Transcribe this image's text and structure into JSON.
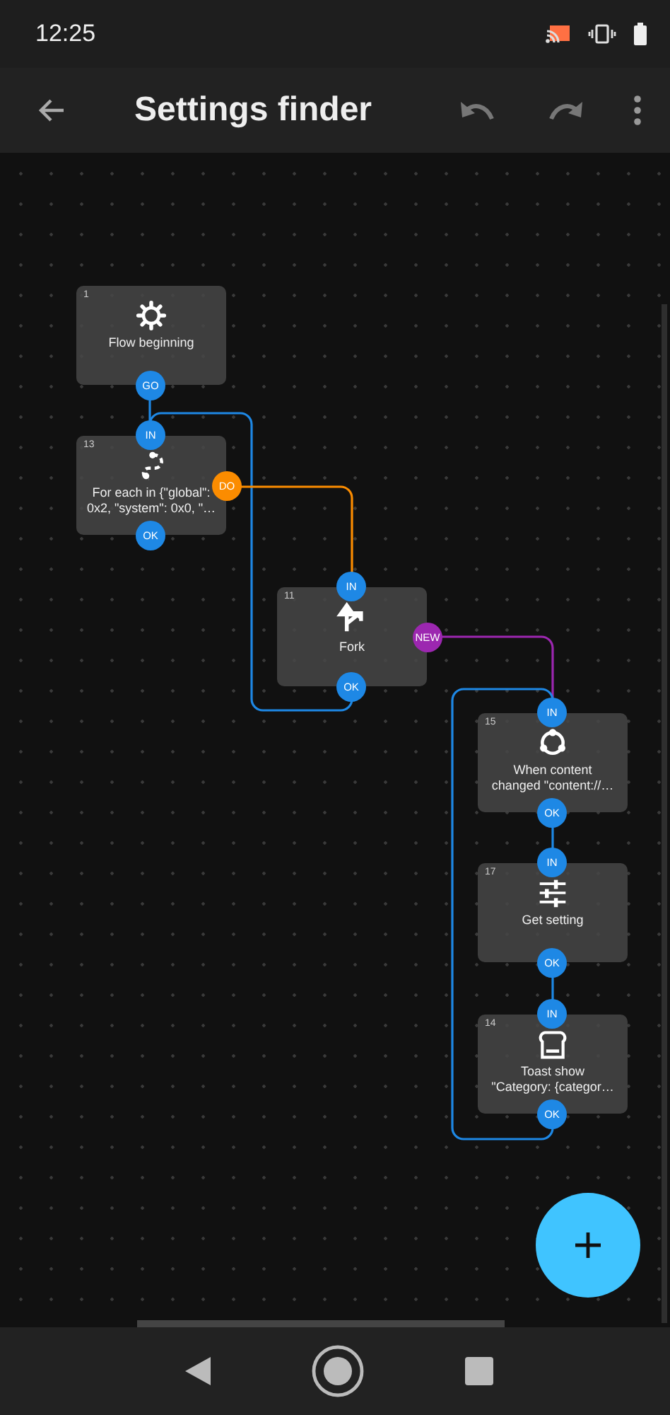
{
  "status_bar": {
    "time": "12:25"
  },
  "app_bar": {
    "title": "Settings finder"
  },
  "nodes": [
    {
      "number": "1",
      "kind": "gear",
      "title": "Flow beginning",
      "ports": [
        {
          "label": "GO",
          "color": "#1e88e5"
        }
      ]
    },
    {
      "number": "13",
      "kind": "loop",
      "title": "For each in {\"global\":\n0x2, \"system\": 0x0, \"…",
      "ports": [
        {
          "label": "IN",
          "color": "#1e88e5"
        },
        {
          "label": "DO",
          "color": "#fb8c00"
        },
        {
          "label": "OK",
          "color": "#1e88e5"
        }
      ]
    },
    {
      "number": "11",
      "kind": "fork",
      "title": "Fork",
      "ports": [
        {
          "label": "IN",
          "color": "#1e88e5"
        },
        {
          "label": "NEW",
          "color": "#9c27b0"
        },
        {
          "label": "OK",
          "color": "#1e88e5"
        }
      ]
    },
    {
      "number": "15",
      "kind": "sync",
      "title": "When content\nchanged \"content://…",
      "ports": [
        {
          "label": "IN",
          "color": "#1e88e5"
        },
        {
          "label": "OK",
          "color": "#1e88e5"
        }
      ]
    },
    {
      "number": "17",
      "kind": "sliders",
      "title": "Get setting",
      "ports": [
        {
          "label": "IN",
          "color": "#1e88e5"
        },
        {
          "label": "OK",
          "color": "#1e88e5"
        }
      ]
    },
    {
      "number": "14",
      "kind": "toast",
      "title": "Toast show\n\"Category: {categor…",
      "ports": [
        {
          "label": "IN",
          "color": "#1e88e5"
        },
        {
          "label": "OK",
          "color": "#1e88e5"
        }
      ]
    }
  ]
}
